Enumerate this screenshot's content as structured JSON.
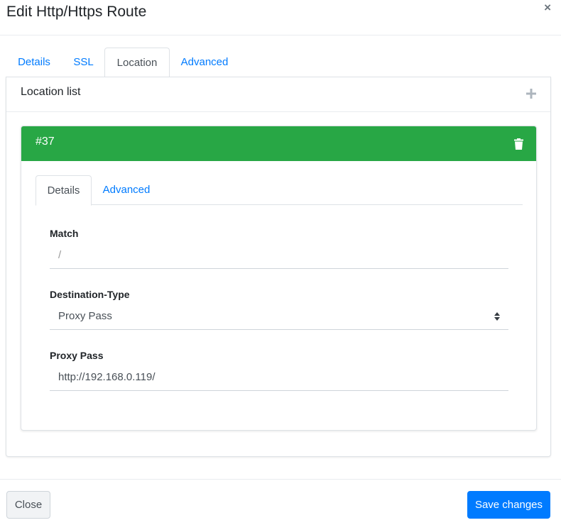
{
  "modal": {
    "title": "Edit Http/Https Route",
    "close_glyph": "×"
  },
  "outer_tabs": [
    {
      "label": "Details",
      "active": false
    },
    {
      "label": "SSL",
      "active": false
    },
    {
      "label": "Location",
      "active": true
    },
    {
      "label": "Advanced",
      "active": false
    }
  ],
  "location_list": {
    "title": "Location list",
    "add_icon": "plus-icon"
  },
  "location": {
    "id_label": "#37",
    "header_color": "#28a745",
    "delete_icon": "trash-icon",
    "tabs": [
      {
        "label": "Details",
        "active": true
      },
      {
        "label": "Advanced",
        "active": false
      }
    ],
    "fields": {
      "match": {
        "label": "Match",
        "placeholder": "/",
        "value": ""
      },
      "destination_type": {
        "label": "Destination-Type",
        "value": "Proxy Pass"
      },
      "proxy_pass": {
        "label": "Proxy Pass",
        "value": "http://192.168.0.119/"
      }
    }
  },
  "footer": {
    "close_label": "Close",
    "save_label": "Save changes",
    "save_color": "#007bff"
  }
}
